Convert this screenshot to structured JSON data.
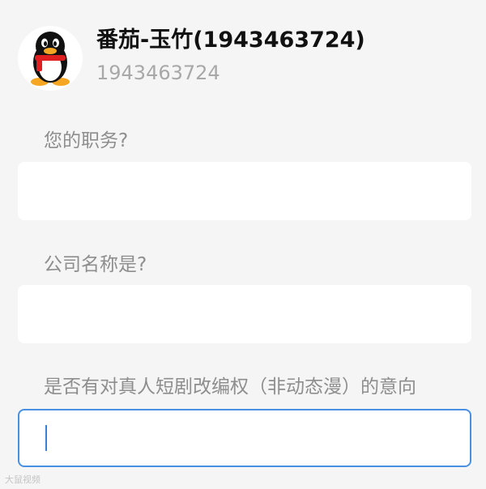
{
  "profile": {
    "name": "番茄-玉竹(1943463724)",
    "id": "1943463724",
    "avatar_icon": "qq-penguin-icon"
  },
  "form": {
    "questions": [
      {
        "label": "您的职务?",
        "value": ""
      },
      {
        "label": "公司名称是?",
        "value": ""
      },
      {
        "label": "是否有对真人短剧改编权（非动态漫）的意向",
        "value": ""
      }
    ]
  },
  "watermark": "大鼠视频",
  "colors": {
    "background": "#f5f5f5",
    "focus_border": "#4a90e2"
  }
}
